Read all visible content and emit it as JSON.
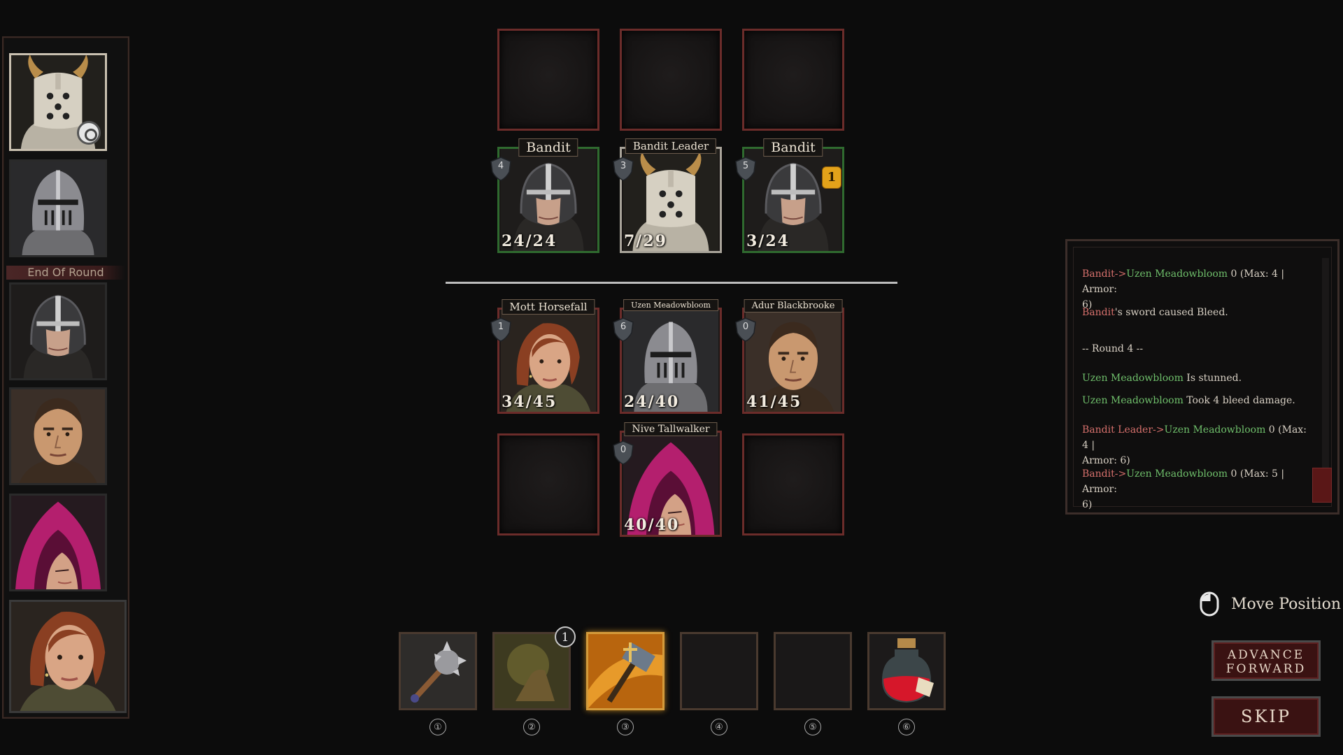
{
  "turn_order": {
    "end_of_round_label": "End Of Round",
    "portraits": [
      "bandit-leader",
      "uzen-meadowbloom",
      "bandit",
      "adur-blackbrooke",
      "nive-tallwalker",
      "mott-horsefall"
    ]
  },
  "enemies": [
    {
      "name": "Bandit",
      "position": "4",
      "hp": "24/24"
    },
    {
      "name": "Bandit Leader",
      "position": "3",
      "hp": "7/29"
    },
    {
      "name": "Bandit",
      "position": "5",
      "hp": "3/24",
      "status_count": "1"
    }
  ],
  "allies": [
    {
      "name": "Mott Horsefall",
      "position": "1",
      "hp": "34/45"
    },
    {
      "name": "Uzen Meadowbloom",
      "position": "6",
      "hp": "24/40"
    },
    {
      "name": "Adur Blackbrooke",
      "position": "0",
      "hp": "41/45"
    },
    {
      "name": "Nive Tallwalker",
      "position": "0",
      "hp": "40/40"
    }
  ],
  "combat_log": {
    "line1": {
      "attacker": "Bandit",
      "arrow": "->",
      "target": "Uzen Meadowbloom",
      "rest": " 0 (Max: 4 | Armor:",
      "cont": "6)"
    },
    "line2": {
      "actor": "Bandit",
      "rest": "'s sword caused Bleed."
    },
    "line3": {
      "text": "-- Round 4 --"
    },
    "line4": {
      "actor": "Uzen Meadowbloom",
      "rest": " Is stunned."
    },
    "line5": {
      "actor": "Uzen Meadowbloom",
      "rest": " Took 4 bleed damage."
    },
    "line6": {
      "attacker": "Bandit Leader",
      "arrow": "->",
      "target": "Uzen Meadowbloom",
      "rest": " 0 (Max: 4 |",
      "cont": "Armor: 6)"
    },
    "line7": {
      "attacker": "Bandit",
      "arrow": "->",
      "target": "Uzen Meadowbloom",
      "rest": " 0 (Max: 5 | Armor:",
      "cont": "6)"
    }
  },
  "skills": [
    {
      "icon": "spiked-mace-icon",
      "key": "①"
    },
    {
      "icon": "glowing-hand-icon",
      "key": "②",
      "cooldown": "1"
    },
    {
      "icon": "holy-hammer-icon",
      "key": "③",
      "active": true
    },
    {
      "icon": "empty-slot",
      "key": "④"
    },
    {
      "icon": "empty-slot",
      "key": "⑤"
    },
    {
      "icon": "health-potion-icon",
      "key": "⑥"
    }
  ],
  "controls": {
    "move_position_label": "Move Position",
    "advance_forward_label": "ADVANCE FORWARD",
    "skip_label": "SKIP"
  },
  "colors": {
    "enemy_name": "#d6706c",
    "ally_name": "#6fbf6b",
    "enemy_frame": "#2f6a2f",
    "ally_frame": "#6b2c2a",
    "active_skill": "#d49b3b"
  }
}
